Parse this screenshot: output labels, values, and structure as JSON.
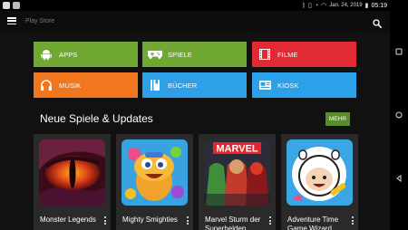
{
  "status_bar": {
    "date": "Jan. 24, 2019",
    "time": "05:19",
    "notification_icons": [
      "notification-app-icon",
      "notification-gallery-icon"
    ],
    "system_icons": [
      "bluetooth-icon",
      "vibrate-icon",
      "alarm-icon",
      "wifi-icon",
      "battery-icon"
    ]
  },
  "toolbar": {
    "search_placeholder": "Play Store",
    "menu_icon": "hamburger-menu-icon",
    "search_icon": "search-icon"
  },
  "categories": [
    {
      "label": "APPS",
      "color": "#70a832",
      "icon": "android-icon"
    },
    {
      "label": "SPIELE",
      "color": "#70a832",
      "icon": "gamepad-icon"
    },
    {
      "label": "FILME",
      "color": "#e12a33",
      "icon": "film-icon"
    },
    {
      "label": "MUSIK",
      "color": "#f0771e",
      "icon": "headphones-icon"
    },
    {
      "label": "BÜCHER",
      "color": "#2ea0e7",
      "icon": "book-icon"
    },
    {
      "label": "KIOSK",
      "color": "#2aa1e8",
      "icon": "newspaper-icon"
    }
  ],
  "section": {
    "title": "Neue Spiele & Updates",
    "more_label": "MEHR",
    "more_color": "#5a8d29"
  },
  "cards": [
    {
      "title": "Monster Legends",
      "art": "dragon-eye-art"
    },
    {
      "title": "Mighty Smighties",
      "art": "cartoon-creature-art"
    },
    {
      "title": "Marvel Sturm der Superhelden",
      "art": "marvel-heroes-art"
    },
    {
      "title": "Adventure Time Game Wizard",
      "art": "finn-character-art"
    }
  ],
  "navigation_bar": {
    "icons": [
      "recent-apps-icon",
      "home-icon",
      "back-icon"
    ]
  }
}
